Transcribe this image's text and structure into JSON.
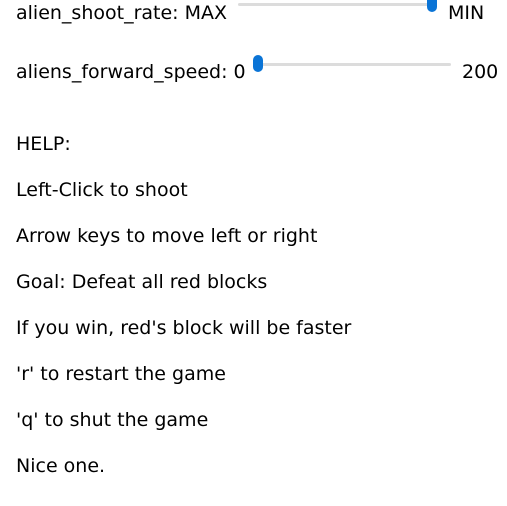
{
  "sliders": {
    "shoot_rate": {
      "label": "alien_shoot_rate: MAX",
      "end_label": "MIN"
    },
    "forward_speed": {
      "label": "aliens_forward_speed: 0",
      "end_label": "200",
      "value": 0
    }
  },
  "help": {
    "title": "HELP:",
    "lines": [
      "Left-Click to shoot",
      "Arrow keys to move left or right",
      "Goal: Defeat all red blocks",
      "If you win, red's block will be faster",
      "'r' to restart the game",
      "'q' to shut the game",
      "Nice one."
    ]
  },
  "colors": {
    "slider_thumb": "#0a74d6",
    "slider_track": "#dcdcdc"
  }
}
